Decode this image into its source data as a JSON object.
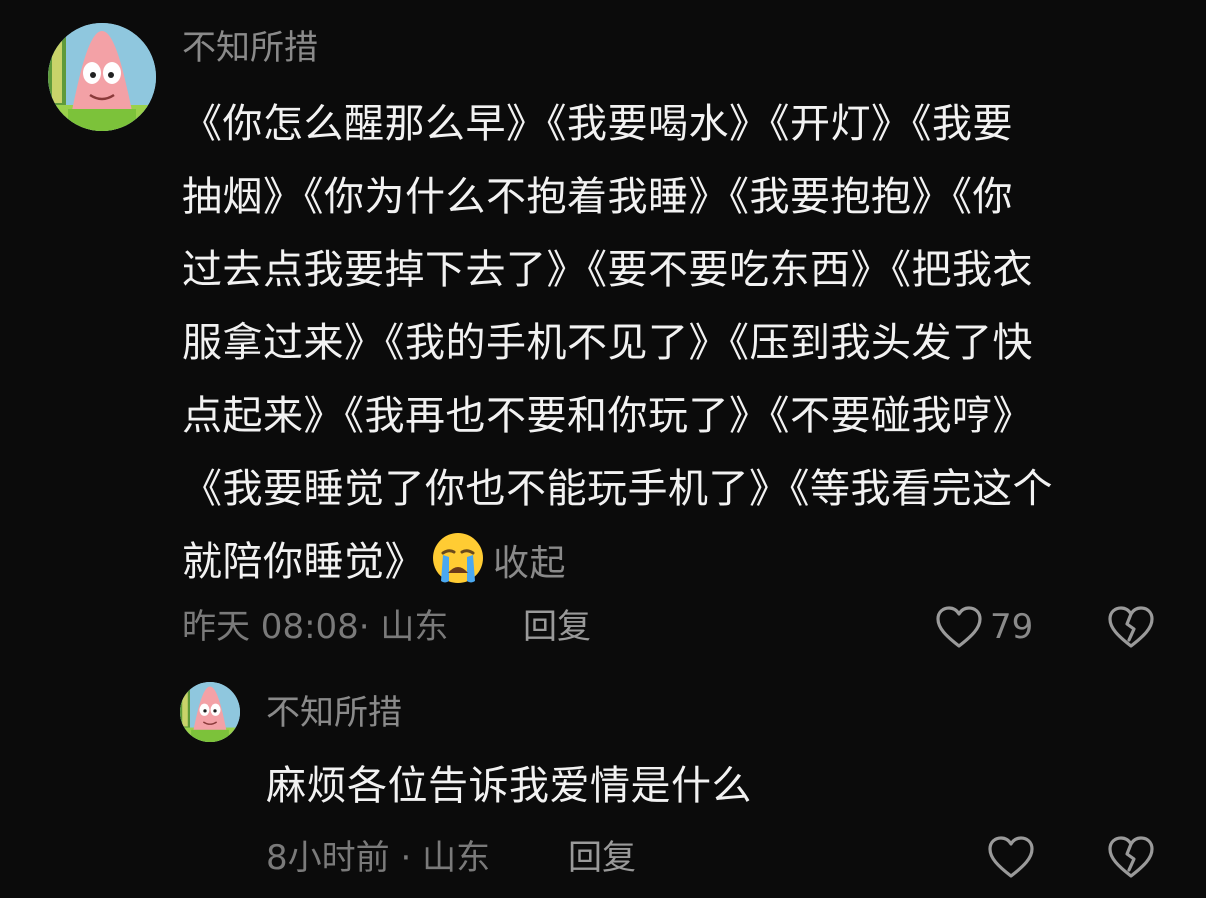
{
  "comments": [
    {
      "username": "不知所措",
      "text_lines": [
        "《你怎么醒那么早》《我要喝水》《开灯》《我要",
        "抽烟》《你为什么不抱着我睡》《我要抱抱》《你",
        "过去点我要掉下去了》《要不要吃东西》《把我衣",
        "服拿过来》《我的手机不见了》《压到我头发了快",
        "点起来》《我再也不要和你玩了》《不要碰我哼》",
        "《我要睡觉了你也不能玩手机了》《等我看完这个",
        "就陪你睡觉》"
      ],
      "emoji": "crying-face-emoji",
      "collapse_label": "收起",
      "time": "昨天 08:08",
      "separator": "·",
      "location": "山东",
      "reply_label": "回复",
      "like_count": "79"
    },
    {
      "username": "不知所措",
      "text": "麻烦各位告诉我爱情是什么",
      "time": "8小时前",
      "separator": "·",
      "location": "山东",
      "reply_label": "回复"
    }
  ],
  "colors": {
    "background": "#0b0b0b",
    "text": "#f2f2f2",
    "muted": "#8a8a8a"
  }
}
